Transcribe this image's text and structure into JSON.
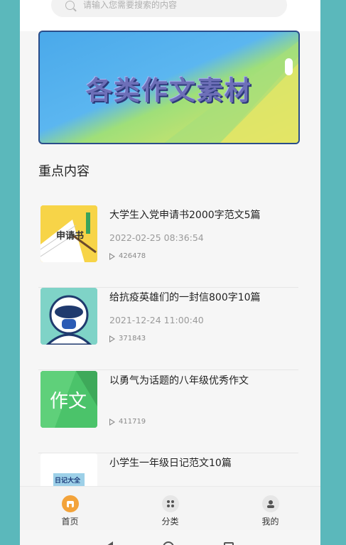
{
  "search": {
    "placeholder": "请输入您需要搜索的内容"
  },
  "banner": {
    "title": "各类作文素材"
  },
  "section": {
    "title": "重点内容"
  },
  "articles": [
    {
      "title": "大学生入党申请书2000字范文5篇",
      "date": "2022-02-25 08:36:54",
      "views": "426478",
      "thumb_text": "申请书"
    },
    {
      "title": "给抗疫英雄们的一封信800字10篇",
      "date": "2021-12-24 11:00:40",
      "views": "371843",
      "thumb_text": ""
    },
    {
      "title": "以勇气为话题的八年级优秀作文",
      "date": "",
      "views": "411719",
      "thumb_text": "作文"
    },
    {
      "title": "小学生一年级日记范文10篇",
      "date": "",
      "views": "",
      "thumb_text": "日记大全"
    }
  ],
  "tabbar": {
    "items": [
      {
        "label": "首页",
        "icon": "home-icon",
        "active": true
      },
      {
        "label": "分类",
        "icon": "grid-icon",
        "active": false
      },
      {
        "label": "我的",
        "icon": "user-icon",
        "active": false
      }
    ]
  },
  "colors": {
    "background": "#5bb8bb",
    "accent": "#f3a33a",
    "text": "#222222",
    "muted": "#9a9a9a"
  }
}
